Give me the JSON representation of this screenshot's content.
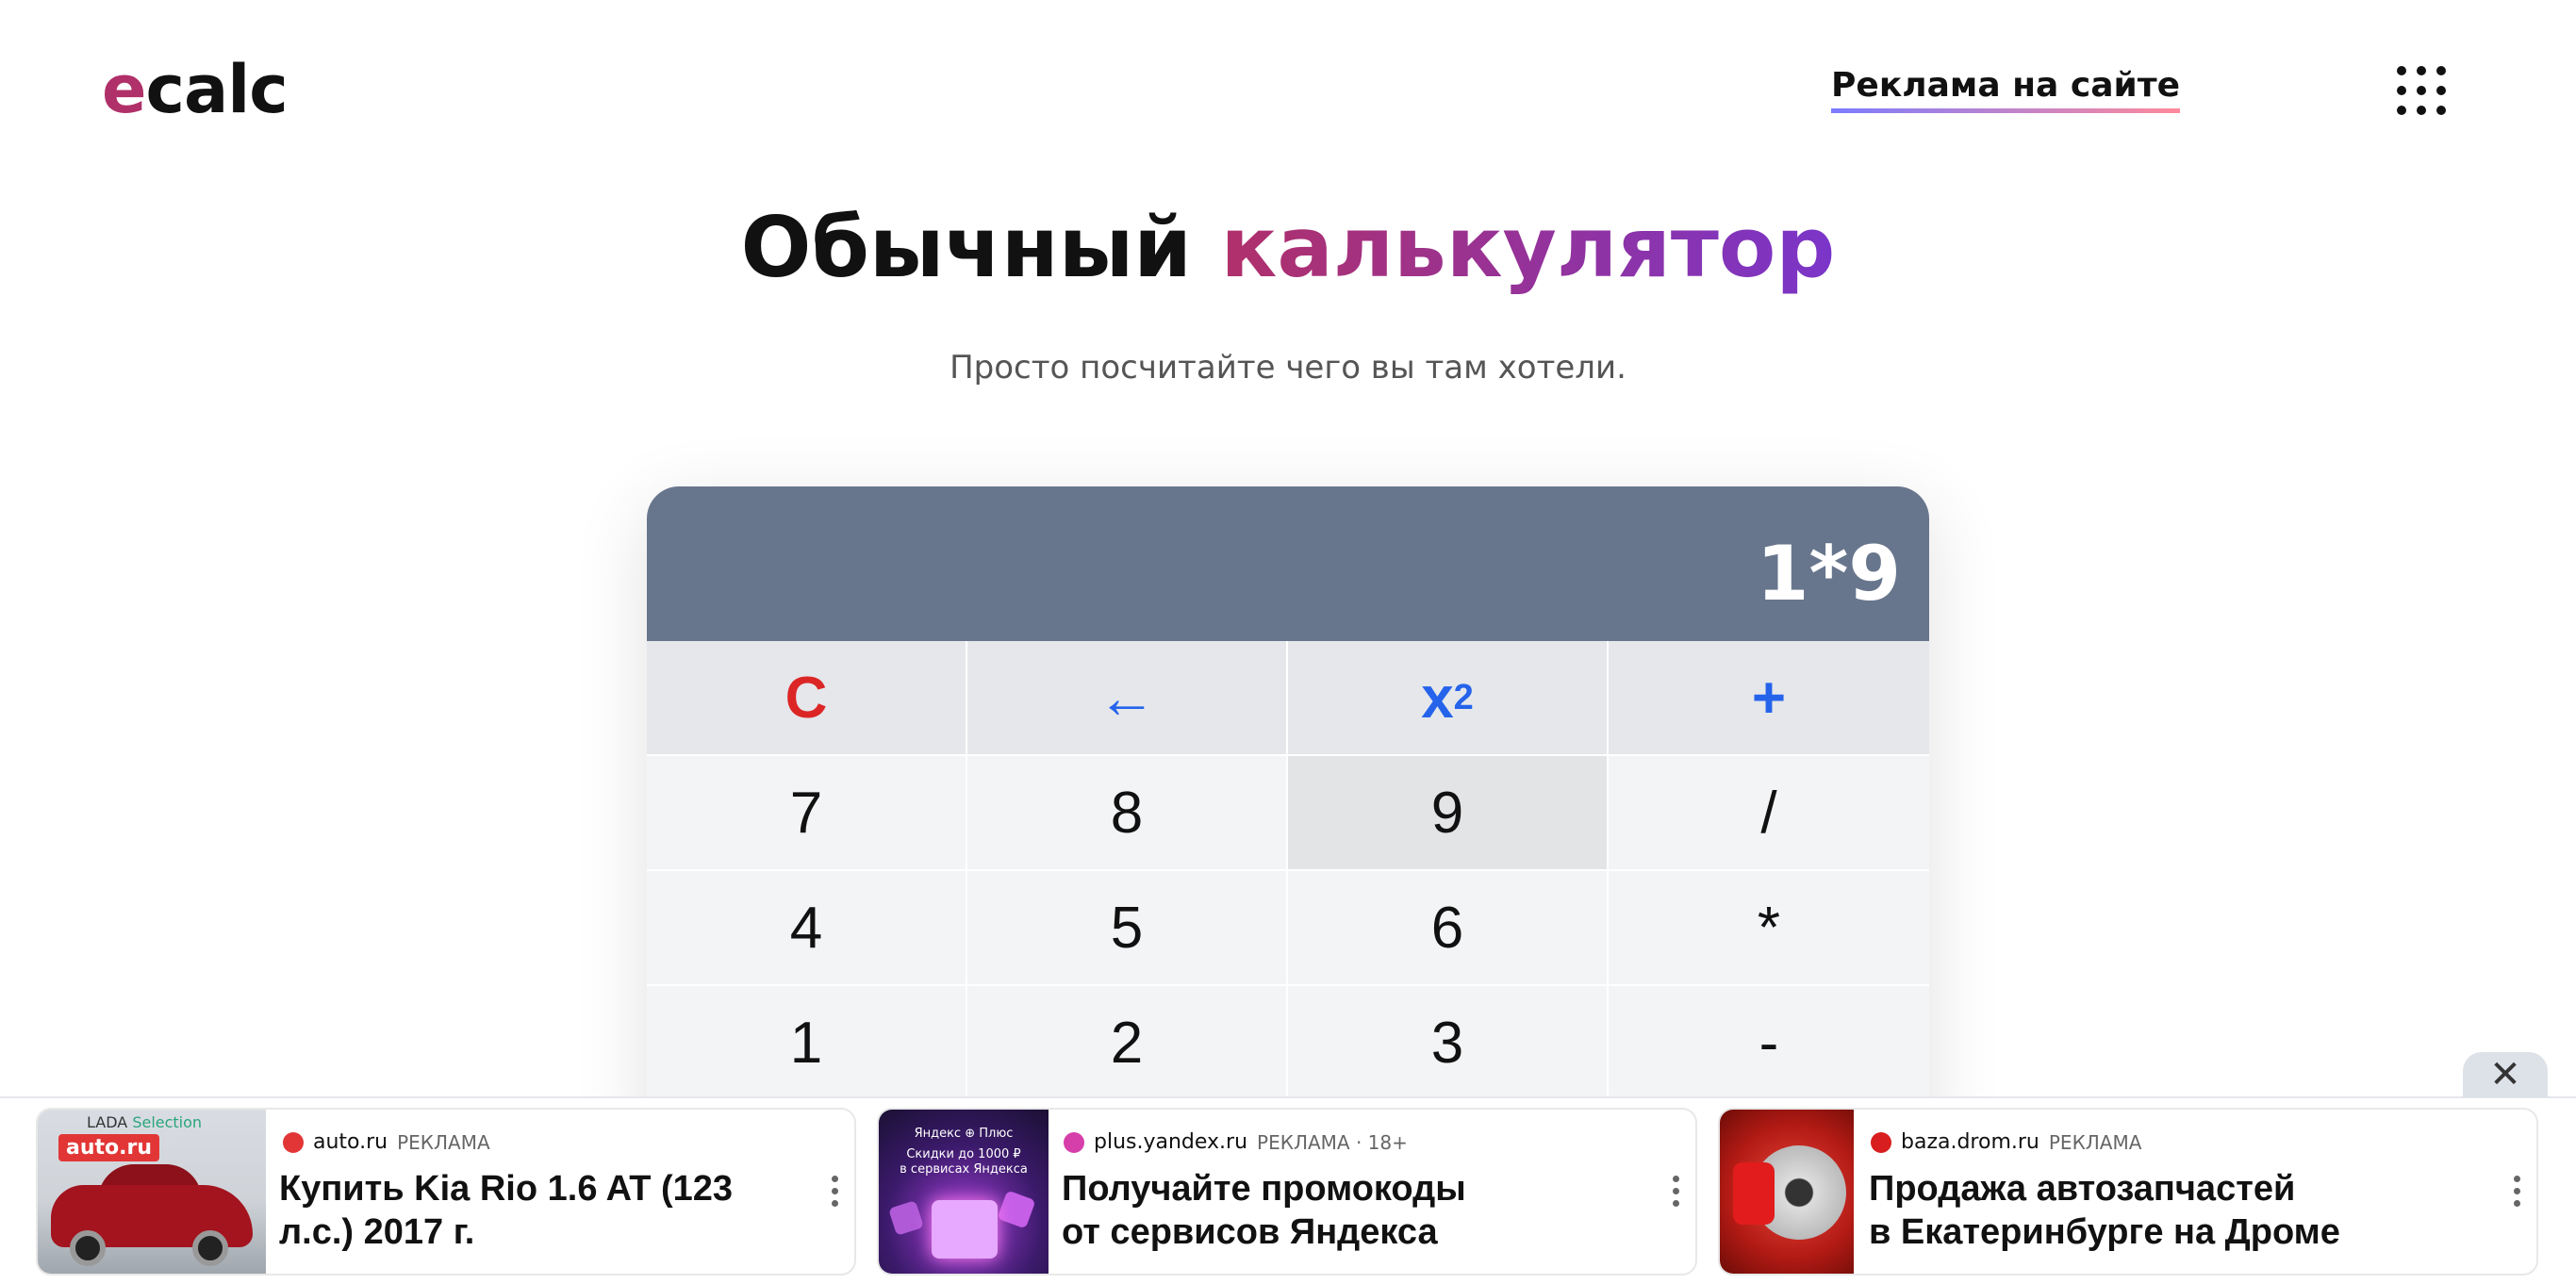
{
  "header": {
    "logo_first": "e",
    "logo_rest": "calc",
    "ads_link": "Реклама на сайте",
    "apps_icon": "grid-dots-icon"
  },
  "page": {
    "title_part1": "Обычный",
    "title_part2": "калькулятор",
    "subtitle": "Просто посчитайте чего вы там хотели."
  },
  "calculator": {
    "display": "1*9",
    "keys": {
      "clear": "C",
      "backspace": "←",
      "square_base": "x",
      "square_sup": "2",
      "plus": "+",
      "k7": "7",
      "k8": "8",
      "k9": "9",
      "divide": "/",
      "k4": "4",
      "k5": "5",
      "k6": "6",
      "multiply": "*",
      "k1": "1",
      "k2": "2",
      "k3": "3",
      "minus": "-"
    },
    "colors": {
      "display_bg": "#68768d",
      "clear": "#dc2626",
      "operator_blue": "#2563eb"
    }
  },
  "ads": {
    "close": "✕",
    "label": "РЕКЛАМА",
    "items": [
      {
        "source": "auto.ru",
        "meta": "РЕКЛАМА",
        "headline_line1": "Купить Kia Rio 1.6 AT (123",
        "headline_line2": "л.с.) 2017 г.",
        "thumb_brand": "auto.ru",
        "thumb_lada": "LADA",
        "thumb_selection": "Selection",
        "favicon_color": "#e23636"
      },
      {
        "source": "plus.yandex.ru",
        "meta": "РЕКЛАМА · 18+",
        "headline_line1": "Получайте промокоды",
        "headline_line2": "от сервисов Яндекса",
        "thumb_line1": "Яндекс ⊕ Плюс",
        "thumb_line2": "Скидки до 1000 ₽",
        "thumb_line3": "в сервисах Яндекса",
        "favicon_color": "#d63fa9"
      },
      {
        "source": "baza.drom.ru",
        "meta": "РЕКЛАМА",
        "headline_line1": "Продажа автозапчастей",
        "headline_line2": "в Екатеринбурге на Дроме",
        "favicon_color": "#d81e1e"
      }
    ]
  }
}
